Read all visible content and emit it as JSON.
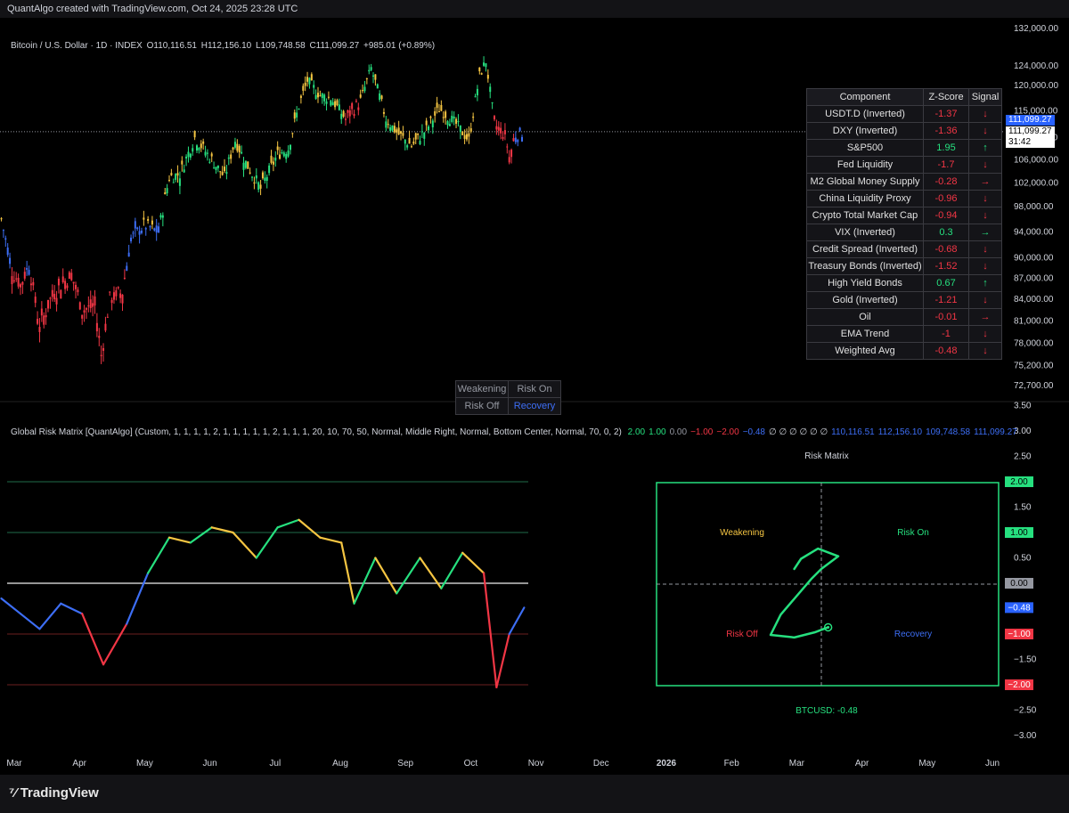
{
  "header": {
    "credit": "QuantAlgo created with TradingView.com, Oct 24, 2025 23:28 UTC"
  },
  "legend": {
    "symbol": "Bitcoin / U.S. Dollar · 1D · INDEX",
    "open": "O110,116.51",
    "high": "H112,156.10",
    "low": "L109,748.58",
    "close": "C111,099.27",
    "change": "+985.01 (+0.89%)"
  },
  "indicator_legend": {
    "name": "Global Risk Matrix [QuantAlgo] (Custom, 1, 1, 1, 1, 2, 1, 1, 1, 1, 1, 2, 1, 1, 1, 20, 10, 70, 50, Normal, Middle Right, Normal, Bottom Center, Normal, 70, 0, 2)",
    "values": [
      {
        "text": "2.00",
        "color": "#26e07f"
      },
      {
        "text": "1.00",
        "color": "#26e07f"
      },
      {
        "text": "0.00",
        "color": "#9598a1"
      },
      {
        "text": "−1.00",
        "color": "#f23645"
      },
      {
        "text": "−2.00",
        "color": "#f23645"
      },
      {
        "text": "−0.48",
        "color": "#3d6ef5"
      },
      {
        "text": "∅ ∅ ∅ ∅ ∅ ∅",
        "color": "#d1d4dc"
      },
      {
        "text": "110,116.51",
        "color": "#3d6ef5"
      },
      {
        "text": "112,156.10",
        "color": "#3d6ef5"
      },
      {
        "text": "109,748.58",
        "color": "#3d6ef5"
      },
      {
        "text": "111,099.27",
        "color": "#3d6ef5"
      }
    ]
  },
  "risk_table": {
    "headers": [
      "Component",
      "Z-Score",
      "Signal"
    ],
    "rows": [
      {
        "component": "USDT.D (Inverted)",
        "z": "-1.37",
        "signal": "↓",
        "color": "#f23645"
      },
      {
        "component": "DXY (Inverted)",
        "z": "-1.36",
        "signal": "↓",
        "color": "#f23645"
      },
      {
        "component": "S&P500",
        "z": "1.95",
        "signal": "↑",
        "color": "#26e07f"
      },
      {
        "component": "Fed Liquidity",
        "z": "-1.7",
        "signal": "↓",
        "color": "#f23645"
      },
      {
        "component": "M2 Global Money Supply",
        "z": "-0.28",
        "signal": "→",
        "color": "#f23645"
      },
      {
        "component": "China Liquidity Proxy",
        "z": "-0.96",
        "signal": "↓",
        "color": "#f23645"
      },
      {
        "component": "Crypto Total Market Cap",
        "z": "-0.94",
        "signal": "↓",
        "color": "#f23645"
      },
      {
        "component": "VIX (Inverted)",
        "z": "0.3",
        "signal": "→",
        "color": "#26e07f"
      },
      {
        "component": "Credit Spread (Inverted)",
        "z": "-0.68",
        "signal": "↓",
        "color": "#f23645"
      },
      {
        "component": "Treasury Bonds (Inverted)",
        "z": "-1.52",
        "signal": "↓",
        "color": "#f23645"
      },
      {
        "component": "High Yield Bonds",
        "z": "0.67",
        "signal": "↑",
        "color": "#26e07f"
      },
      {
        "component": "Gold (Inverted)",
        "z": "-1.21",
        "signal": "↓",
        "color": "#f23645"
      },
      {
        "component": "Oil",
        "z": "-0.01",
        "signal": "→",
        "color": "#f23645"
      },
      {
        "component": "EMA Trend",
        "z": "-1",
        "signal": "↓",
        "color": "#f23645"
      },
      {
        "component": "Weighted Avg",
        "z": "-0.48",
        "signal": "↓",
        "color": "#f23645"
      }
    ]
  },
  "quadrant_legend": [
    [
      {
        "text": "Weakening",
        "color": "#9598a1"
      },
      {
        "text": "Risk On",
        "color": "#9598a1"
      }
    ],
    [
      {
        "text": "Risk Off",
        "color": "#9598a1"
      },
      {
        "text": "Recovery",
        "color": "#3d6ef5"
      }
    ]
  ],
  "risk_matrix": {
    "title": "Risk Matrix",
    "quadrants": {
      "weakening": {
        "label": "Weakening",
        "color": "#f5c542"
      },
      "risk_on": {
        "label": "Risk On",
        "color": "#26e07f"
      },
      "risk_off": {
        "label": "Risk Off",
        "color": "#f23645"
      },
      "recovery": {
        "label": "Recovery",
        "color": "#3d6ef5"
      }
    },
    "footer": "BTCUSD: -0.48",
    "frame_color": "#26e07f"
  },
  "price_tags": {
    "last_blue": "111,099.27",
    "last_white": "111,099.27",
    "countdown": "31:42"
  },
  "colors": {
    "up": "#26e07f",
    "weak": "#f5c542",
    "down": "#f23645",
    "recovery": "#3d6ef5",
    "bg": "#000000"
  },
  "footer": {
    "brand": "TradingView"
  },
  "chart_data": [
    {
      "type": "candlestick",
      "title": "Bitcoin / U.S. Dollar · 1D · INDEX",
      "y_ticks": [
        "132,000.00",
        "124,000.00",
        "120,000.00",
        "115,000.00",
        "110,000.00",
        "106,000.00",
        "102,000.00",
        "98,000.00",
        "94,000.00",
        "90,000.00",
        "87,000.00",
        "84,000.00",
        "81,000.00",
        "78,000.00",
        "75,200.00",
        "72,700.00"
      ],
      "x_ticks": [
        "Mar",
        "Apr",
        "May",
        "Jun",
        "Jul",
        "Aug",
        "Sep",
        "Oct",
        "Nov",
        "Dec",
        "2026",
        "Feb",
        "Mar",
        "Apr",
        "May",
        "Jun"
      ],
      "series_close": [
        {
          "date": "2025-02-20",
          "close": 96000
        },
        {
          "date": "2025-02-25",
          "close": 88000
        },
        {
          "date": "2025-03-01",
          "close": 86000
        },
        {
          "date": "2025-03-05",
          "close": 89000
        },
        {
          "date": "2025-03-10",
          "close": 80000
        },
        {
          "date": "2025-03-15",
          "close": 84000
        },
        {
          "date": "2025-03-20",
          "close": 86000
        },
        {
          "date": "2025-03-25",
          "close": 87500
        },
        {
          "date": "2025-03-30",
          "close": 82500
        },
        {
          "date": "2025-04-05",
          "close": 83000
        },
        {
          "date": "2025-04-08",
          "close": 76500
        },
        {
          "date": "2025-04-12",
          "close": 84000
        },
        {
          "date": "2025-04-18",
          "close": 85000
        },
        {
          "date": "2025-04-22",
          "close": 93000
        },
        {
          "date": "2025-04-28",
          "close": 95000
        },
        {
          "date": "2025-05-05",
          "close": 94000
        },
        {
          "date": "2025-05-10",
          "close": 103000
        },
        {
          "date": "2025-05-15",
          "close": 103500
        },
        {
          "date": "2025-05-22",
          "close": 110000
        },
        {
          "date": "2025-05-28",
          "close": 107000
        },
        {
          "date": "2025-06-05",
          "close": 103000
        },
        {
          "date": "2025-06-10",
          "close": 109500
        },
        {
          "date": "2025-06-15",
          "close": 105500
        },
        {
          "date": "2025-06-22",
          "close": 101000
        },
        {
          "date": "2025-06-30",
          "close": 107000
        },
        {
          "date": "2025-07-05",
          "close": 108000
        },
        {
          "date": "2025-07-10",
          "close": 116000
        },
        {
          "date": "2025-07-14",
          "close": 121000
        },
        {
          "date": "2025-07-20",
          "close": 118000
        },
        {
          "date": "2025-07-25",
          "close": 117500
        },
        {
          "date": "2025-08-01",
          "close": 113500
        },
        {
          "date": "2025-08-08",
          "close": 117000
        },
        {
          "date": "2025-08-13",
          "close": 123500
        },
        {
          "date": "2025-08-20",
          "close": 113500
        },
        {
          "date": "2025-08-25",
          "close": 111000
        },
        {
          "date": "2025-09-01",
          "close": 108500
        },
        {
          "date": "2025-09-08",
          "close": 111500
        },
        {
          "date": "2025-09-14",
          "close": 115500
        },
        {
          "date": "2025-09-22",
          "close": 112500
        },
        {
          "date": "2025-09-28",
          "close": 109500
        },
        {
          "date": "2025-10-03",
          "close": 122000
        },
        {
          "date": "2025-10-06",
          "close": 125000
        },
        {
          "date": "2025-10-10",
          "close": 112500
        },
        {
          "date": "2025-10-15",
          "close": 110500
        },
        {
          "date": "2025-10-17",
          "close": 106500
        },
        {
          "date": "2025-10-20",
          "close": 110500
        },
        {
          "date": "2025-10-24",
          "close": 111099.27
        }
      ]
    },
    {
      "type": "line",
      "title": "Global Risk Matrix [QuantAlgo]",
      "ylim": [
        -3.0,
        3.5
      ],
      "y_ticks": [
        "3.50",
        "3.00",
        "2.50",
        "2.00",
        "1.50",
        "1.00",
        "0.50",
        "0.00",
        "−0.48",
        "−1.00",
        "−1.50",
        "−2.00",
        "−2.50",
        "−3.00"
      ],
      "reference_lines": [
        2,
        1,
        0,
        -1,
        -2
      ],
      "x": [
        "2025-02-20",
        "2025-03-01",
        "2025-03-10",
        "2025-03-20",
        "2025-03-30",
        "2025-04-09",
        "2025-04-20",
        "2025-04-30",
        "2025-05-10",
        "2025-05-20",
        "2025-05-30",
        "2025-06-09",
        "2025-06-20",
        "2025-06-30",
        "2025-07-10",
        "2025-07-20",
        "2025-07-30",
        "2025-08-05",
        "2025-08-15",
        "2025-08-25",
        "2025-09-05",
        "2025-09-15",
        "2025-09-25",
        "2025-10-05",
        "2025-10-11",
        "2025-10-17",
        "2025-10-24"
      ],
      "values": [
        -0.3,
        -0.6,
        -0.9,
        -0.4,
        -0.6,
        -1.6,
        -0.8,
        0.2,
        0.9,
        0.8,
        1.1,
        1.0,
        0.5,
        1.1,
        1.25,
        0.9,
        0.8,
        -0.4,
        0.5,
        -0.2,
        0.5,
        -0.1,
        0.6,
        0.2,
        -2.05,
        -1.0,
        -0.48
      ]
    },
    {
      "type": "scatter",
      "title": "Risk Matrix",
      "x_center": 0,
      "y_center": 0,
      "path": [
        {
          "x": -0.8,
          "y": 0.3
        },
        {
          "x": -0.6,
          "y": 0.5
        },
        {
          "x": -0.1,
          "y": 0.7
        },
        {
          "x": 0.5,
          "y": 0.55
        },
        {
          "x": 0.0,
          "y": 0.3
        },
        {
          "x": -0.3,
          "y": 0.1
        },
        {
          "x": -1.2,
          "y": -0.6
        },
        {
          "x": -1.5,
          "y": -1.0
        },
        {
          "x": -0.8,
          "y": -1.05
        },
        {
          "x": -0.2,
          "y": -0.95
        },
        {
          "x": 0.2,
          "y": -0.85
        }
      ],
      "current": {
        "x": 0.2,
        "y": -0.85
      }
    }
  ]
}
